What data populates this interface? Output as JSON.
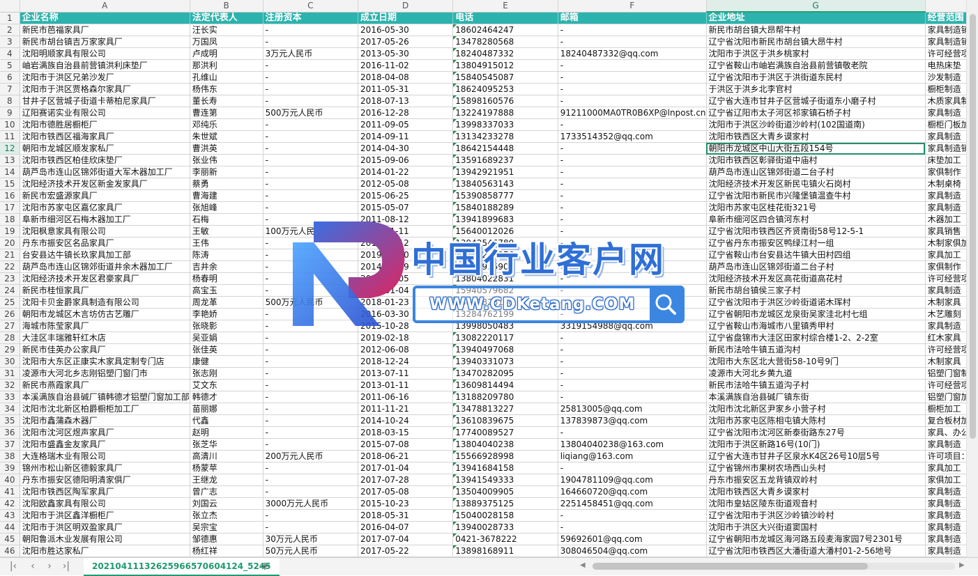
{
  "columns": [
    "A",
    "B",
    "C",
    "D",
    "E",
    "F",
    "G"
  ],
  "selected_column": "G",
  "selected_row": 12,
  "header_row": {
    "row": 1,
    "cells": [
      "企业名称",
      "法定代表人",
      "注册资本",
      "成立日期",
      "电话",
      "邮箱",
      "企业地址",
      "经营范围"
    ]
  },
  "rows": [
    {
      "n": 2,
      "c": [
        "新民市芭福家具厂",
        "汪长实",
        "-",
        "2016-05-30",
        "18602464247",
        "-",
        "新民市胡台镇大昂帮牛村",
        "家具制造销"
      ]
    },
    {
      "n": 3,
      "c": [
        "新民市胡台镇吉万家家具厂",
        "万国凤",
        "-",
        "2017-05-26",
        "13478280568",
        "-",
        "辽宁省沈阳市新民市胡台镇大昂牛村",
        "家具制造销"
      ]
    },
    {
      "n": 4,
      "c": [
        "沈阳明顺家具有限公司",
        "卢成明",
        "3万元人民币",
        "2013-05-30",
        "18240487332",
        "18240487332@qq.com",
        "沈阳市于洪区于洪乡桃家村",
        "许可经营项"
      ]
    },
    {
      "n": 5,
      "c": [
        "岫岩满族自治县前营镇洪利床垫厂",
        "那洪利",
        "-",
        "2016-11-02",
        "13804915012",
        "-",
        "辽宁省鞍山市岫岩满族自治县前营镇敬老院",
        "电热床垫"
      ]
    },
    {
      "n": 6,
      "c": [
        "沈阳市于洪区兄弟沙发厂",
        "孔维山",
        "-",
        "2018-04-08",
        "15840545087",
        "-",
        "辽宁省沈阳市于洪区于洪街道东民村",
        "沙发制造"
      ]
    },
    {
      "n": 7,
      "c": [
        "沈阳市于洪区贾格森尔家具厂",
        "杨伟东",
        "-",
        "2011-05-31",
        "18624095253",
        "-",
        "于洪区于洪乡北李官村",
        "橱柜制造"
      ]
    },
    {
      "n": 8,
      "c": [
        "甘井子区营城子街道卡蒂柏尼家具厂",
        "董长寿",
        "-",
        "2018-07-13",
        "15898160576",
        "-",
        "辽宁省大连市甘井子区营城子街道东小磨子村",
        "木质家具制"
      ]
    },
    {
      "n": 9,
      "c": [
        "辽阳赛诺实业有限公司",
        "曹连第",
        "500万元人民币",
        "2016-12-28",
        "13224197888",
        "91211000MA0TR0B6XP@lnpost.cn",
        "辽宁省辽阳市太子河区祁家镇石桥子村",
        "家具制造"
      ]
    },
    {
      "n": 10,
      "c": [
        "沈阳市德胜居橱柜厂",
        "邓纯乐",
        "-",
        "2011-09-05",
        "13998337033",
        "-",
        "沈阳市于洪区沙岭街道沙岭村(102国道南)",
        "橱柜门板加"
      ]
    },
    {
      "n": 11,
      "c": [
        "沈阳市铁西区福海家具厂",
        "朱世斌",
        "-",
        "2014-09-11",
        "13134233278",
        "1733514352@qq.com",
        "沈阳市铁西区大青乡谟家村",
        "家具制造"
      ]
    },
    {
      "n": 12,
      "c": [
        "朝阳市龙城区顺发家私厂",
        "曹洪英",
        "-",
        "2014-04-30",
        "18642154448",
        "-",
        "朝阳市龙城区中山大街五段154号",
        "家具制造销"
      ]
    },
    {
      "n": 13,
      "c": [
        "沈阳市铁西区柏佳欣床垫厂",
        "张业伟",
        "-",
        "2015-09-06",
        "13591689237",
        "-",
        "沈阳市铁西区彰驿街道中庙村",
        "床垫加工"
      ]
    },
    {
      "n": 14,
      "c": [
        "葫芦岛市连山区锦郊街道大军木器加工厂",
        "李丽新",
        "-",
        "2014-01-22",
        "13942921951",
        "-",
        "葫芦岛市连山区锦郊街道二台子村",
        "家俱制作"
      ]
    },
    {
      "n": 15,
      "c": [
        "沈阳经济技术开发区新金发家具厂",
        "蔡勇",
        "-",
        "2012-05-08",
        "13840563143",
        "-",
        "沈阳经济技术开发区新民屯镇火石岗村",
        "木制桌椅"
      ]
    },
    {
      "n": 16,
      "c": [
        "新民市宏盛源家具厂",
        "曹海建",
        "-",
        "2015-06-25",
        "15390858777",
        "-",
        "辽宁省沈阳市新民市兴隆堡镇温查牛村",
        "家具制造"
      ]
    },
    {
      "n": 17,
      "c": [
        "沈阳市苏家屯区嘉亿家具厂",
        "张旭峰",
        "-",
        "2015-05-07",
        "15840188289",
        "-",
        "沈阳市苏家屯区桂花街321号",
        "家具制造"
      ]
    },
    {
      "n": 18,
      "c": [
        "阜新市细河区石梅木器加工厂",
        "石梅",
        "-",
        "2011-08-12",
        "13941899683",
        "-",
        "阜新市细河区四合镇河东村",
        "木器加工"
      ]
    },
    {
      "n": 19,
      "c": [
        "沈阳枫意家具有限公司",
        "王敏",
        "100万元人民币",
        "2016-11-11",
        "15640012026",
        "-",
        "辽宁省沈阳市铁西区齐贤南街58号12-5-1",
        "家具销售"
      ]
    },
    {
      "n": 20,
      "c": [
        "丹东市振安区名品家具厂",
        "王伟",
        "-",
        "2013-02-12",
        "13942546780",
        "-",
        "辽宁省丹东市振安区鸭绿江村一组",
        "木制家俱加"
      ]
    },
    {
      "n": 21,
      "c": [
        "台安县达牛镇长玖家具加工部",
        "陈涛",
        "-",
        "2019-03-20",
        "13941281976",
        "-",
        "辽宁省鞍山市台安县达牛镇大田村四组",
        "家具加工"
      ]
    },
    {
      "n": 22,
      "c": [
        "葫芦岛市连山区锦郊街道井余木器加工厂",
        "吉井余",
        "-",
        "2014-05-19",
        "13942935906",
        "-",
        "葫芦岛市连山区锦郊街道二台子村",
        "家俱制作"
      ]
    },
    {
      "n": 23,
      "c": [
        "沈阳经济技术开发区君豪家具厂",
        "杨春明",
        "-",
        "2012-09-05",
        "13804022831",
        "-",
        "沈阳经济技术开发区高花街道高花村",
        "许可经营项"
      ]
    },
    {
      "n": 24,
      "c": [
        "新民市桂恒家具厂",
        "高宝玉",
        "-",
        "2016-01-04",
        "15940579682",
        "-",
        "新民市胡台镇侯三家子村",
        "家具制造"
      ]
    },
    {
      "n": 25,
      "c": [
        "沈阳卡贝金爵家具制造有限公司",
        "周龙革",
        "500万元人民币",
        "2018-01-23",
        "13609823180",
        "-",
        "辽宁省沈阳市于洪区沙岭街道诺木珲村",
        "木制家具"
      ]
    },
    {
      "n": 26,
      "c": [
        "朝阳市龙城区木言坊仿古艺雕厂",
        "李艳娇",
        "-",
        "2016-03-30",
        "13284762199",
        "-",
        "辽宁省朝阳市龙城区龙泉街吴家洼北村七组",
        "木艺雕刻"
      ]
    },
    {
      "n": 27,
      "c": [
        "海城市陈莹家具厂",
        "张晓影",
        "-",
        "2015-10-28",
        "13998050483",
        "3319154988@qq.com",
        "辽宁省鞍山市海城市八里镇秀甲村",
        "家具制造"
      ]
    },
    {
      "n": 28,
      "c": [
        "大洼区丰瑞雅轩红木店",
        "吴亚娟",
        "-",
        "2019-02-18",
        "13082220117",
        "-",
        "辽宁省盘锦市大洼区田家村综合楼1-2、2-2室",
        "红木家具"
      ]
    },
    {
      "n": 29,
      "c": [
        "新民市佳英办公家具厂",
        "张佳英",
        "-",
        "2012-06-08",
        "13940497068",
        "-",
        "新民市法哈牛镇五道沟村",
        "许可经营项"
      ]
    },
    {
      "n": 30,
      "c": [
        "沈阳市大东区正康实木家具定制专门店",
        "康健",
        "-",
        "2018-12-24",
        "13940331073",
        "-",
        "沈阳市大东区北大营街58-10号9门",
        "木制家具"
      ]
    },
    {
      "n": 31,
      "c": [
        "凌源市大河北乡志刚铝塑门窗门市",
        "张志刚",
        "-",
        "2013-07-11",
        "13470282095",
        "-",
        "凌源市大河北乡黄九道",
        "铝塑门窗制"
      ]
    },
    {
      "n": 32,
      "c": [
        "新民市燕霞家具厂",
        "艾文东",
        "-",
        "2013-01-11",
        "13609814494",
        "-",
        "新民市法哈牛镇五道沟子村",
        "许可经营项"
      ]
    },
    {
      "n": 33,
      "c": [
        "本溪满族自治县碱厂镇韩德才铝塑门窗加工部",
        "韩德才",
        "-",
        "2011-06-16",
        "13188209780",
        "-",
        "本溪满族自治县碱厂镇东街",
        "铝塑门窗加"
      ]
    },
    {
      "n": 34,
      "c": [
        "沈阳市沈北新区柏爵橱柜加工厂",
        "苗丽娜",
        "-",
        "2011-11-21",
        "13478813227",
        "25813005@qq.com",
        "沈阳市沈北新区尹家乡小营子村",
        "橱柜加工"
      ]
    },
    {
      "n": 35,
      "c": [
        "沈阳市鑫蒲森木器厂",
        "代鑫",
        "-",
        "2014-10-24",
        "13610839675",
        "137839873@qq.com",
        "沈阳市苏家屯区陈相屯镇大陈村",
        "复合板材加"
      ]
    },
    {
      "n": 36,
      "c": [
        "沈阳市沈河区煜声家具厂",
        "赵明",
        "-",
        "2018-03-15",
        "17740089527",
        "-",
        "辽宁省沈阳市沈河区新泰街路东27号",
        "家具、办公"
      ]
    },
    {
      "n": 37,
      "c": [
        "沈阳市盛鑫金友家具厂",
        "张芝华",
        "-",
        "2015-07-08",
        "13804040238",
        "13804040238@163.com",
        "沈阳市于洪区新路16号(10门)",
        "家具制造"
      ]
    },
    {
      "n": 38,
      "c": [
        "大连格瑞木业有限公司",
        "高清川",
        "200万元人民币",
        "2018-06-21",
        "15566928998",
        "liqiang@163.com",
        "辽宁省大连市甘井子区泉水K4区26号10层5号",
        "许可项目："
      ]
    },
    {
      "n": 39,
      "c": [
        "锦州市松山新区德毅家具厂",
        "杨蒙苹",
        "-",
        "2017-01-04",
        "13941684158",
        "-",
        "辽宁省锦州市果树农场西山头村",
        "家具加工"
      ]
    },
    {
      "n": 40,
      "c": [
        "丹东市振安区德阳明清家俱厂",
        "王继龙",
        "-",
        "2017-07-28",
        "13941549333",
        "1904781109@qq.com",
        "丹东市振安区五龙背镇双岭村",
        "家俱加工"
      ]
    },
    {
      "n": 41,
      "c": [
        "沈阳市铁西区陶军家具厂",
        "曾广志",
        "-",
        "2017-05-08",
        "13504009905",
        "164660720@qq.com",
        "沈阳市铁西区大青乡谟家村",
        "家具制造"
      ]
    },
    {
      "n": 42,
      "c": [
        "沈阳欧鑫家具有限公司",
        "刘国云",
        "3000万元人民币",
        "2015-10-23",
        "13889375125",
        "2251458451@qq.com",
        "沈阳市皇姑区陵东街道观音村",
        "家具制造"
      ]
    },
    {
      "n": 43,
      "c": [
        "沈阳市于洪区鑫洋橱柜厂",
        "张立杰",
        "-",
        "2018-05-31",
        "15040028158",
        "-",
        "辽宁省沈阳市于洪区沙岭镇沙岭村",
        "家具制造"
      ]
    },
    {
      "n": 44,
      "c": [
        "沈阳市于洪区明双盈家具厂",
        "吴宗宝",
        "-",
        "2016-04-07",
        "13940028733",
        "-",
        "沈阳市于洪区大兴街道窦国村",
        "家具制造"
      ]
    },
    {
      "n": 45,
      "c": [
        "朝阳鲁派木业发展有限公司",
        "邹德惠",
        "30万元人民币",
        "2017-07-04",
        "0421-3678222",
        "59692601@qq.com",
        "辽宁省朝阳市龙城区海河路五段麦海家园7号2301号",
        "家具制造"
      ]
    },
    {
      "n": 46,
      "c": [
        "沈阳市胜达家私厂",
        "杨红祥",
        "50万元人民币",
        "2017-05-22",
        "13898168911",
        "308046504@qq.com",
        "辽宁省沈阳市铁西区大潘街道大潘村01-2-56地号",
        "家具制造"
      ]
    }
  ],
  "sheet_tab": "20210411132625966570604124_5245",
  "add_sheet_label": "+",
  "nav_icons": [
    "first-sheet-icon",
    "prev-sheet-icon",
    "next-sheet-icon",
    "last-sheet-icon"
  ],
  "watermark": {
    "title": "中国行业客户网",
    "url": "WWW.CDKetang.COM"
  },
  "colors": {
    "header_fill": "#2cb3ad",
    "accent": "#1f9a6f",
    "watermark_blue": "#2f6fd6"
  }
}
